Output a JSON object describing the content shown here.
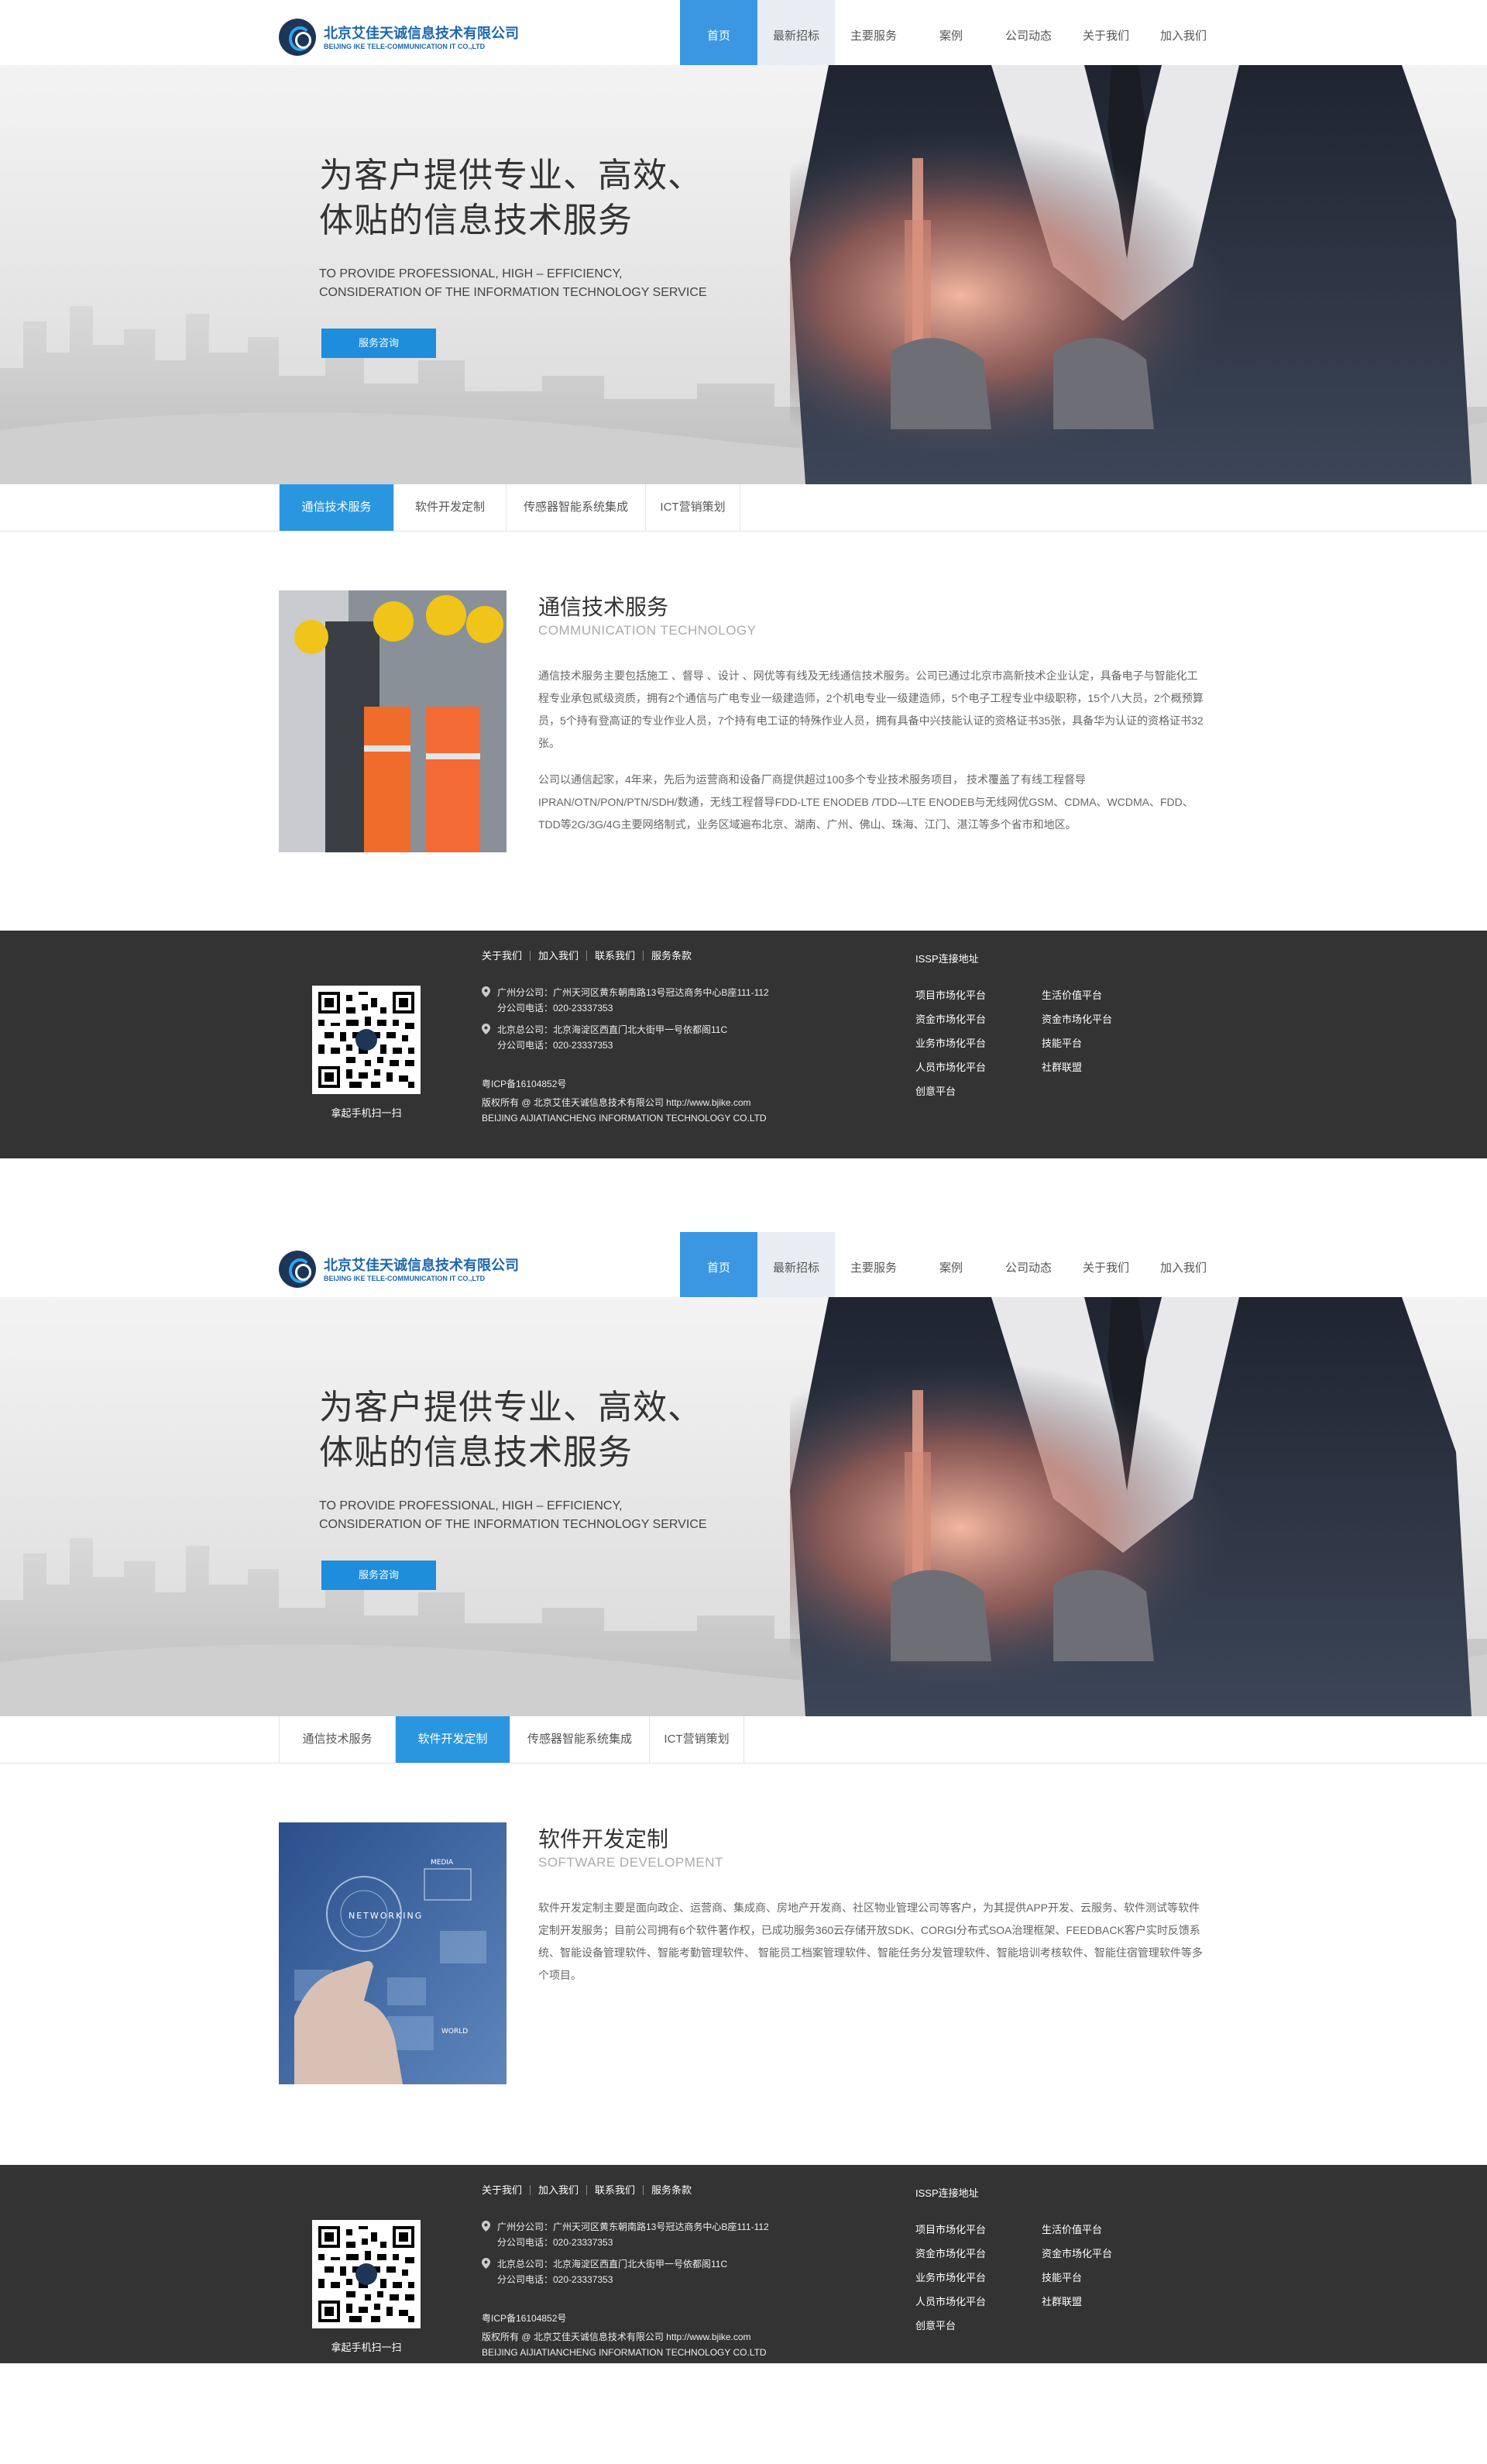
{
  "header": {
    "logo_cn": "北京艾佳天诚信息技术有限公司",
    "logo_en": "BEIJING IKE TELE-COMMUNICATION IT CO.,LTD",
    "nav": [
      "首页",
      "最新招标",
      "主要服务",
      "案例",
      "公司动态",
      "关于我们",
      "加入我们"
    ]
  },
  "banner": {
    "title_line1": "为客户提供专业、高效、",
    "title_line2": "体贴的信息技术服务",
    "en_line1": "TO PROVIDE PROFESSIONAL, HIGH – EFFICIENCY,",
    "en_line2": "CONSIDERATION OF THE INFORMATION TECHNOLOGY SERVICE",
    "button": "服务咨询"
  },
  "tabs": [
    "通信技术服务",
    "软件开发定制",
    "传感器智能系统集成",
    "ICT营销策划"
  ],
  "page1": {
    "title": "通信技术服务",
    "title_en": "COMMUNICATION TECHNOLOGY",
    "para1": "通信技术服务主要包括施工 、督导 、设计 、网优等有线及无线通信技术服务。公司已通过北京市高新技术企业认定，具备电子与智能化工程专业承包贰级资质，拥有2个通信与广电专业一级建造师，2个机电专业一级建造师，5个电子工程专业中级职称，15个八大员，2个概预算员，5个持有登高证的专业作业人员，7个持有电工证的特殊作业人员，拥有具备中兴技能认证的资格证书35张，具备华为认证的资格证书32张。",
    "para2": "公司以通信起家，4年来，先后为运营商和设备厂商提供超过100多个专业技术服务项目， 技术覆盖了有线工程督导IPRAN/OTN/PON/PTN/SDH/数通，无线工程督导FDD-LTE ENODEB /TDD-–LTE ENODEB与无线网优GSM、CDMA、WCDMA、FDD、TDD等2G/3G/4G主要网络制式，业务区域遍布北京、湖南、广州、佛山、珠海、江门、湛江等多个省市和地区。"
  },
  "page2": {
    "title": "软件开发定制",
    "title_en": "SOFTWARE DEVELOPMENT",
    "para1": "软件开发定制主要是面向政企、运营商、集成商、房地产开发商、社区物业管理公司等客户，为其提供APP开发、云服务、软件测试等软件定制开发服务；目前公司拥有6个软件著作权，已成功服务360云存储开放SDK、CORGI分布式SOA治理框架、FEEDBACK客户实时反馈系统、智能设备管理软件、智能考勤管理软件、 智能员工档案管理软件、智能任务分发管理软件、智能培训考核软件、智能住宿管理软件等多个项目。",
    "photo_words": [
      "NETWORKING",
      "MEDIA",
      "WORLD"
    ]
  },
  "footer": {
    "links": [
      "关于我们",
      "加入我们",
      "联系我们",
      "服务条款"
    ],
    "gz_label": "广州分公司：广州天河区黄东朝南路13号冠达商务中心B座111-112",
    "gz_phone": "分公司电话：020-23337353",
    "bj_label": "北京总公司：北京海淀区西直门北大街甲一号依都阁11C",
    "bj_phone": "分公司电话：020-23337353",
    "icp": "粤ICP备16104852号",
    "copyright": "版权所有 @ 北京艾佳天诚信息技术有限公司 http://www.bjike.com",
    "company_en": "BEIJING AIJIATIANCHENG INFORMATION TECHNOLOGY CO.LTD",
    "qr_caption": "拿起手机扫一扫",
    "issp_title": "ISSP连接地址",
    "issp_col1": [
      "项目市场化平台",
      "资金市场化平台",
      "业务市场化平台",
      "人员市场化平台",
      "创意平台"
    ],
    "issp_col2": [
      "生活价值平台",
      "资金市场化平台",
      "技能平台",
      "社群联盟"
    ]
  },
  "colors": {
    "accent": "#2b96e0",
    "footer_bg": "#333333",
    "nav_active": "#3c97e2"
  }
}
